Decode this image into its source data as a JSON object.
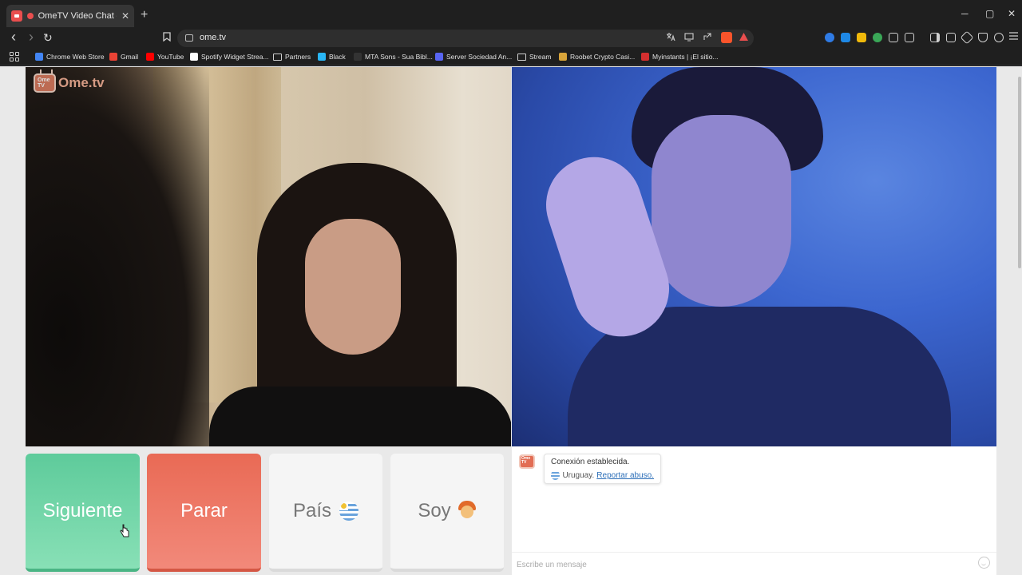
{
  "browser": {
    "tab": {
      "title": "OmeTV Video Chat — Omegl",
      "close": "✕"
    },
    "new_tab": "+",
    "window_controls": {
      "minimize": "─",
      "maximize": "▢",
      "close": "✕"
    },
    "nav": {
      "back": "‹",
      "forward": "›",
      "reload": "↻"
    },
    "address": {
      "url": "ome.tv"
    },
    "bookmarks": [
      {
        "label": "Chrome Web Store",
        "color": "#4285f4"
      },
      {
        "label": "Gmail",
        "color": "#ea4335"
      },
      {
        "label": "YouTube",
        "color": "#ff0000"
      },
      {
        "label": "Spotify Widget Strea...",
        "color": "#ffffff"
      },
      {
        "label": "Partners",
        "color": ""
      },
      {
        "label": "Black",
        "color": "#29b6f6"
      },
      {
        "label": "MTA Sons - Sua Bibl...",
        "color": "#333333"
      },
      {
        "label": "Server Sociedad An...",
        "color": "#5865f2"
      },
      {
        "label": "Stream",
        "color": ""
      },
      {
        "label": "Roobet Crypto Casi...",
        "color": "#d8a43a"
      },
      {
        "label": "Myinstants | ¡El sitio...",
        "color": "#d32f2f"
      }
    ]
  },
  "site": {
    "logo_text": "Ome.tv",
    "logo_badge": "Ome TV",
    "buttons": {
      "next": "Siguiente",
      "stop": "Parar",
      "country": "País",
      "gender": "Soy"
    },
    "chat": {
      "logo_badge": "Ome TV",
      "message_line1": "Conexión establecida.",
      "country_name": "Uruguay.",
      "report_link": "Reportar abuso.",
      "input_placeholder": "Escribe un mensaje"
    }
  },
  "colors": {
    "next_button": "#5ecb9b",
    "stop_button": "#e96a55",
    "brand": "#e26d54"
  }
}
